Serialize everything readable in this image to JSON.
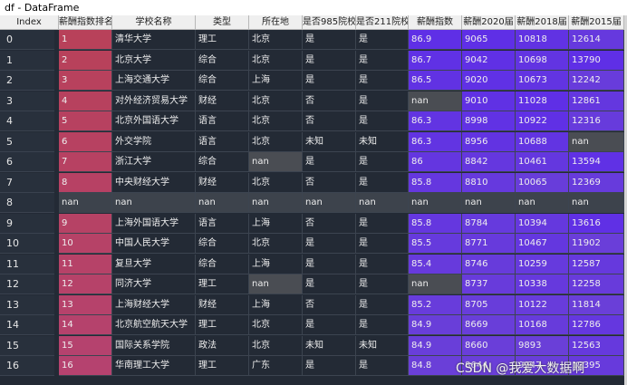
{
  "window": {
    "title": "df - DataFrame"
  },
  "columns": [
    "Index",
    "薪酬指数排名",
    "学校名称",
    "类型",
    "所在地",
    "是否985院校",
    "是否211院校",
    "薪酬指数",
    "薪酬2020届",
    "薪酬2018届",
    "薪酬2015届"
  ],
  "rows": [
    [
      "0",
      "1",
      "清华大学",
      "理工",
      "北京",
      "是",
      "是",
      "86.9",
      "9065",
      "10818",
      "12614"
    ],
    [
      "1",
      "2",
      "北京大学",
      "综合",
      "北京",
      "是",
      "是",
      "86.7",
      "9042",
      "10698",
      "13790"
    ],
    [
      "2",
      "3",
      "上海交通大学",
      "综合",
      "上海",
      "是",
      "是",
      "86.5",
      "9020",
      "10673",
      "12242"
    ],
    [
      "3",
      "4",
      "对外经济贸易大学",
      "财经",
      "北京",
      "否",
      "是",
      "nan",
      "9010",
      "11028",
      "12861"
    ],
    [
      "4",
      "5",
      "北京外国语大学",
      "语言",
      "北京",
      "否",
      "是",
      "86.3",
      "8998",
      "10922",
      "12316"
    ],
    [
      "5",
      "6",
      "外交学院",
      "语言",
      "北京",
      "未知",
      "未知",
      "86.3",
      "8956",
      "10688",
      "nan"
    ],
    [
      "6",
      "7",
      "浙江大学",
      "综合",
      "nan",
      "是",
      "是",
      "86",
      "8842",
      "10461",
      "13594"
    ],
    [
      "7",
      "8",
      "中央财经大学",
      "财经",
      "北京",
      "否",
      "是",
      "85.8",
      "8810",
      "10065",
      "12369"
    ],
    [
      "8",
      "nan",
      "nan",
      "nan",
      "nan",
      "nan",
      "nan",
      "nan",
      "nan",
      "nan",
      "nan"
    ],
    [
      "9",
      "9",
      "上海外国语大学",
      "语言",
      "上海",
      "否",
      "是",
      "85.8",
      "8784",
      "10394",
      "13616"
    ],
    [
      "10",
      "10",
      "中国人民大学",
      "综合",
      "北京",
      "是",
      "是",
      "85.5",
      "8771",
      "10467",
      "11902"
    ],
    [
      "11",
      "11",
      "复旦大学",
      "综合",
      "上海",
      "是",
      "是",
      "85.4",
      "8746",
      "10259",
      "12587"
    ],
    [
      "12",
      "12",
      "同济大学",
      "理工",
      "nan",
      "是",
      "是",
      "nan",
      "8737",
      "10338",
      "12258"
    ],
    [
      "13",
      "13",
      "上海财经大学",
      "财经",
      "上海",
      "否",
      "是",
      "85.2",
      "8705",
      "10122",
      "11814"
    ],
    [
      "14",
      "14",
      "北京航空航天大学",
      "理工",
      "北京",
      "是",
      "是",
      "84.9",
      "8669",
      "10168",
      "12786"
    ],
    [
      "15",
      "15",
      "国际关系学院",
      "政法",
      "北京",
      "未知",
      "未知",
      "84.9",
      "8660",
      "9893",
      "12563"
    ],
    [
      "16",
      "16",
      "华南理工大学",
      "理工",
      "广东",
      "是",
      "是",
      "84.8",
      "8644",
      "9947",
      "12395"
    ]
  ],
  "watermark": "CSDN @我爱大数据啊",
  "colors": {
    "nan_cell": "#4a4d53",
    "nan_row": "#3d434c",
    "grid_bg": "#232a35",
    "rank_high": "#b8415a",
    "rank_low": "#b5426f",
    "blue_high": "#5f2fe6",
    "blue_low": "#6a3fd8"
  }
}
